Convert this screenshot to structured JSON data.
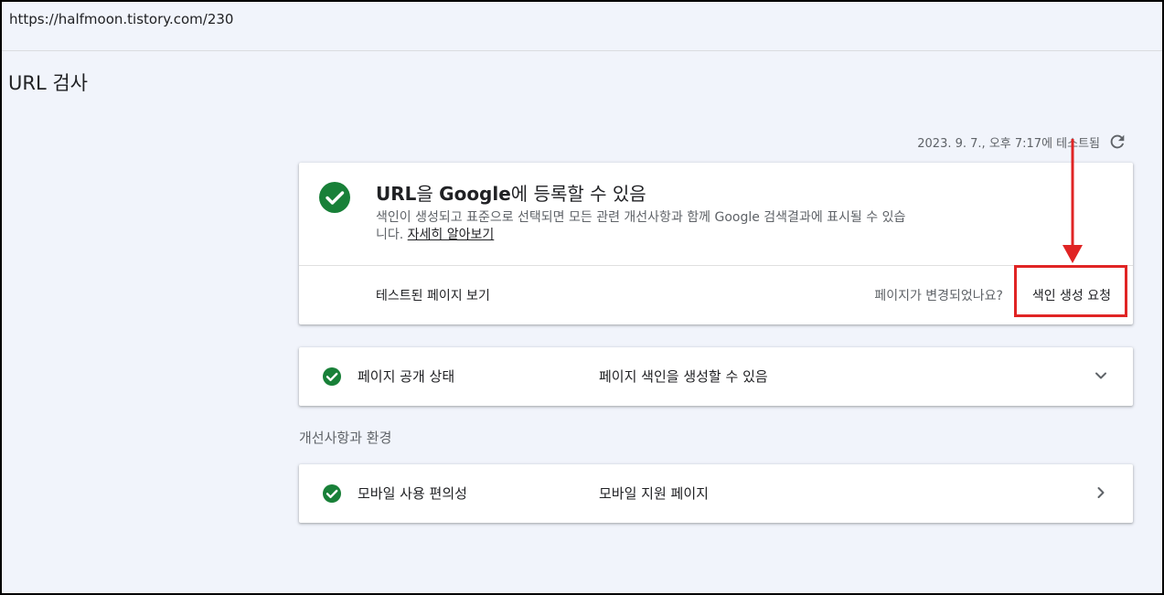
{
  "url_bar": {
    "url": "https://halfmoon.tistory.com/230"
  },
  "page": {
    "title": "URL 검사"
  },
  "test_info": {
    "tested_at": "2023. 9. 7., 오후 7:17에 테스트됨",
    "refresh_icon": "refresh-icon"
  },
  "main_card": {
    "heading_url": "URL",
    "heading_mid": "을 ",
    "heading_google": "Google",
    "heading_end": "에 등록할 수 있음",
    "description": "색인이 생성되고 표준으로 선택되면 모든 관련 개선사항과 함께 Google 검색결과에 표시될 수 있습니다. ",
    "learn_more": "자세히 알아보기",
    "view_tested_page": "테스트된 페이지 보기",
    "changed_question": "페이지가 변경되었나요?",
    "request_indexing": "색인 생성 요청",
    "status_icon": "check-circle-icon"
  },
  "status_card": {
    "label": "페이지 공개 상태",
    "value": "페이지 색인을 생성할 수 있음",
    "icon": "chevron-down-icon"
  },
  "section": {
    "label": "개선사항과 환경"
  },
  "mobile_card": {
    "label": "모바일 사용 편의성",
    "value": "모바일 지원 페이지",
    "icon": "chevron-right-icon"
  },
  "colors": {
    "accent_green": "#188038",
    "highlight_red": "#e02424"
  }
}
